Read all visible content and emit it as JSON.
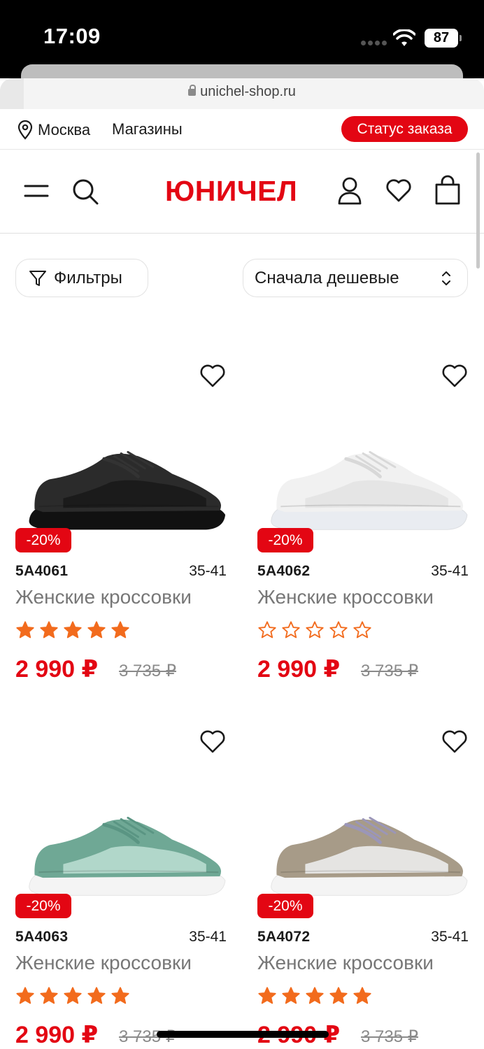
{
  "status_bar": {
    "time": "17:09",
    "battery": "87"
  },
  "browser": {
    "url": "unichel-shop.ru"
  },
  "top_bar": {
    "city": "Москва",
    "stores": "Магазины",
    "order_status": "Статус заказа"
  },
  "header": {
    "logo": "ЮНИЧЕЛ",
    "icons": [
      "menu-icon",
      "search-icon",
      "user-icon",
      "heart-icon",
      "bag-icon"
    ]
  },
  "filters": {
    "filter_label": "Фильтры",
    "sort_label": "Сначала дешевые"
  },
  "colors": {
    "brand": "#e30613",
    "star": "#f26b1d"
  },
  "products": [
    {
      "sku": "5A4061",
      "sizes": "35-41",
      "name": "Женские кроссовки",
      "discount": "-20%",
      "price": "2 990 ₽",
      "old_price": "3 735 ₽",
      "rating": 5,
      "shoe_color": "black"
    },
    {
      "sku": "5A4062",
      "sizes": "35-41",
      "name": "Женские кроссовки",
      "discount": "-20%",
      "price": "2 990 ₽",
      "old_price": "3 735 ₽",
      "rating": 0,
      "shoe_color": "white"
    },
    {
      "sku": "5A4063",
      "sizes": "35-41",
      "name": "Женские кроссовки",
      "discount": "-20%",
      "price": "2 990 ₽",
      "old_price": "3 735 ₽",
      "rating": 5,
      "shoe_color": "mint"
    },
    {
      "sku": "5A4072",
      "sizes": "35-41",
      "name": "Женские кроссовки",
      "discount": "-20%",
      "price": "2 990 ₽",
      "old_price": "3 735 ₽",
      "rating": 5,
      "shoe_color": "beige-white"
    }
  ]
}
